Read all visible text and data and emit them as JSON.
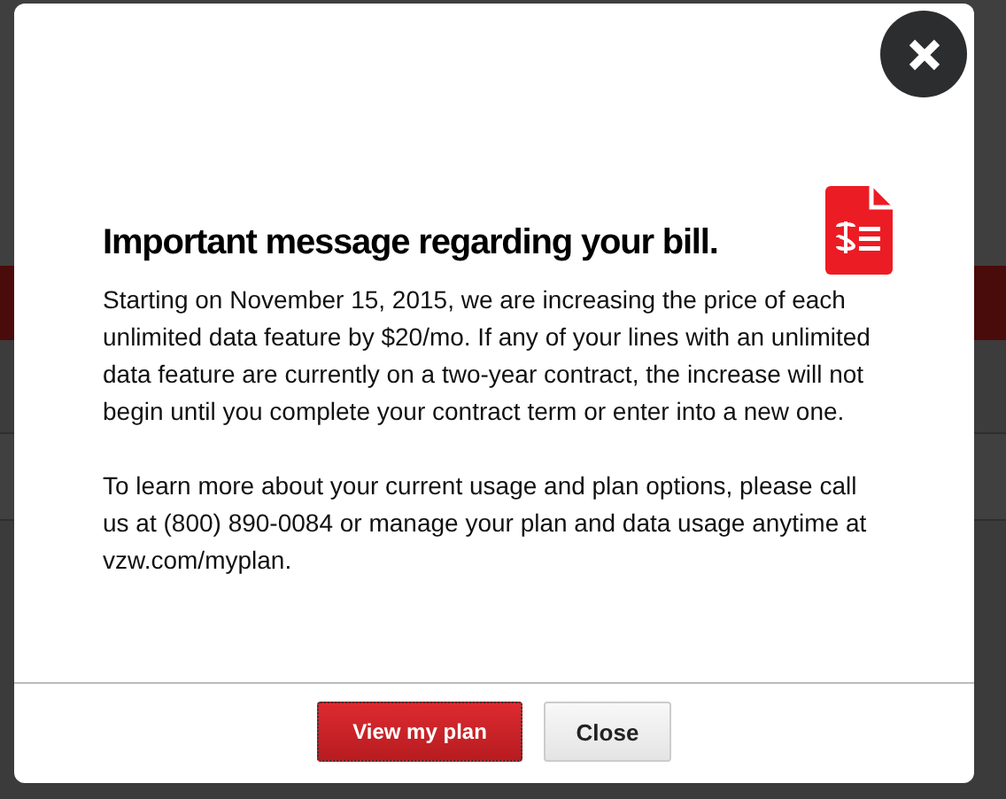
{
  "dialog": {
    "title": "Important message regarding your bill.",
    "paragraphs": [
      "Starting on November 15, 2015, we are increasing the price of each unlimited data feature by $20/mo. If any of your lines with an unlimited data feature are currently on a two-year contract, the increase will not begin until you complete your contract term or enter into a new one.",
      "To learn more about your current usage and plan options, please call us at (800) 890-0084 or manage your plan and data usage anytime at vzw.com/myplan."
    ],
    "buttons": [
      {
        "label": "View my plan",
        "kind": "primary"
      },
      {
        "label": "Close",
        "kind": "secondary"
      }
    ]
  }
}
